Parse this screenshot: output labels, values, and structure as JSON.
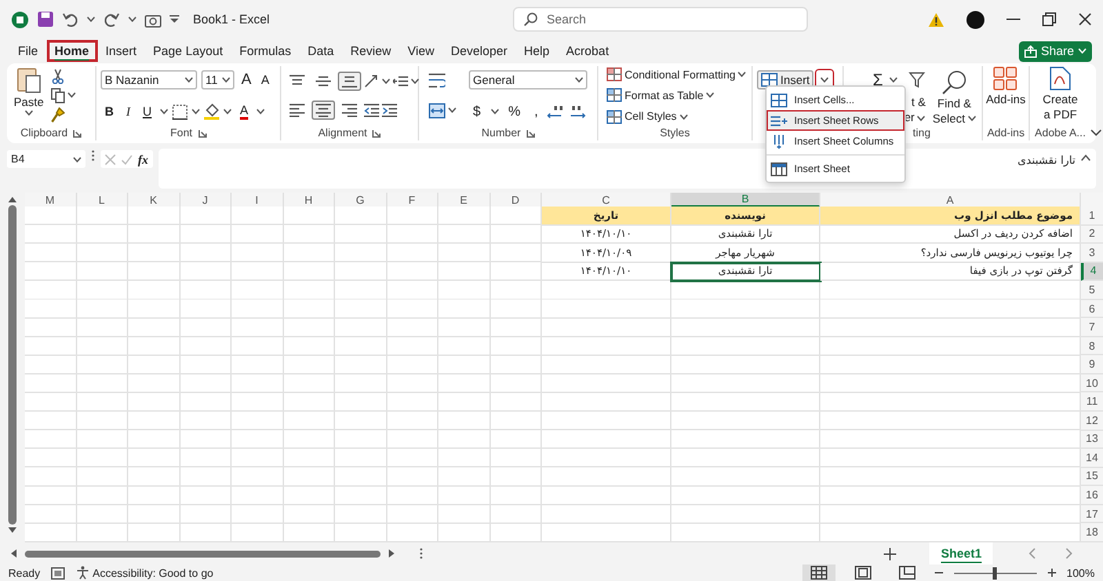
{
  "title_bar": {
    "document": "Book1 - Excel",
    "search": {
      "placeholder": "Search"
    }
  },
  "menu_tabs": [
    {
      "label": "File",
      "selected": false,
      "annotated": false
    },
    {
      "label": "Home",
      "selected": true,
      "annotated": true
    },
    {
      "label": "Insert",
      "selected": false,
      "annotated": false
    },
    {
      "label": "Page Layout",
      "selected": false,
      "annotated": false
    },
    {
      "label": "Formulas",
      "selected": false,
      "annotated": false
    },
    {
      "label": "Data",
      "selected": false,
      "annotated": false
    },
    {
      "label": "Review",
      "selected": false,
      "annotated": false
    },
    {
      "label": "View",
      "selected": false,
      "annotated": false
    },
    {
      "label": "Developer",
      "selected": false,
      "annotated": false
    },
    {
      "label": "Help",
      "selected": false,
      "annotated": false
    },
    {
      "label": "Acrobat",
      "selected": false,
      "annotated": false
    }
  ],
  "share_button": "Share",
  "ribbon": {
    "clipboard": {
      "paste": "Paste",
      "label": "Clipboard"
    },
    "font": {
      "font_name": "B Nazanin",
      "font_size": "11",
      "size_buttons": [
        {
          "kind": "grow",
          "label": "A"
        },
        {
          "kind": "shrink",
          "label": "A"
        }
      ],
      "format_buttons": [
        {
          "kind": "bold",
          "label": "B"
        },
        {
          "kind": "italic",
          "label": "I"
        },
        {
          "kind": "underline",
          "label": "U"
        }
      ],
      "font_color": "A",
      "label": "Font"
    },
    "alignment": {
      "top_row": [
        {
          "kind": "top",
          "selected": false
        },
        {
          "kind": "middle",
          "selected": false
        },
        {
          "kind": "bottom",
          "selected": true
        }
      ],
      "bottom_row": [
        {
          "kind": "left",
          "selected": false
        },
        {
          "kind": "center",
          "selected": true
        },
        {
          "kind": "right",
          "selected": false
        }
      ],
      "label": "Alignment"
    },
    "number": {
      "format": "General",
      "symbols": [
        "$",
        "%",
        ","
      ],
      "label": "Number"
    },
    "styles": {
      "items": [
        "Conditional Formatting",
        "Format as Table",
        "Cell Styles"
      ],
      "label": "Styles"
    },
    "cells": {
      "insert": "Insert",
      "caret_annotated": true
    },
    "editing": {
      "autosum": "Σ",
      "sort_lines": [
        "t &",
        "er"
      ],
      "find_lines": [
        "Find &",
        "Select"
      ],
      "label": "ting"
    },
    "addins": {
      "button": "Add-ins",
      "label": "Add-ins"
    },
    "adobe": {
      "button_lines": [
        "Create",
        "a PDF"
      ],
      "label": "Adobe A..."
    }
  },
  "insert_menu": {
    "items": [
      {
        "kind": "cells",
        "label": "Insert Cells...",
        "annotated": false
      },
      {
        "kind": "rows",
        "label": "Insert Sheet Rows",
        "annotated": true
      },
      {
        "kind": "columns",
        "label": "Insert Sheet Columns",
        "annotated": false
      },
      {
        "kind": "sheet",
        "label": "Insert Sheet",
        "annotated": false
      }
    ]
  },
  "formula_bar": {
    "name_box": "B4",
    "fx": "fx",
    "value": "تارا نقشبندی"
  },
  "sheet": {
    "columns": [
      {
        "label": "M",
        "selected": false
      },
      {
        "label": "L",
        "selected": false
      },
      {
        "label": "K",
        "selected": false
      },
      {
        "label": "J",
        "selected": false
      },
      {
        "label": "I",
        "selected": false
      },
      {
        "label": "H",
        "selected": false
      },
      {
        "label": "G",
        "selected": false
      },
      {
        "label": "F",
        "selected": false
      },
      {
        "label": "E",
        "selected": false
      },
      {
        "label": "D",
        "selected": false
      },
      {
        "label": "C",
        "selected": false
      },
      {
        "label": "B",
        "selected": true
      },
      {
        "label": "A",
        "selected": false
      }
    ],
    "rows": [
      {
        "number": "1",
        "selected": false,
        "kind": "header",
        "cells": [
          {
            "text": "موضوع مطلب انزل وب",
            "selected": false
          },
          {
            "text": "نویسنده",
            "selected": false
          },
          {
            "text": "تاریخ",
            "selected": false
          }
        ]
      },
      {
        "number": "2",
        "selected": false,
        "kind": "data",
        "cells": [
          {
            "text": "اضافه کردن ردیف در اکسل",
            "selected": false
          },
          {
            "text": "تارا نقشبندی",
            "selected": false
          },
          {
            "text": "۱۴۰۴/۱۰/۱۰",
            "selected": false
          }
        ]
      },
      {
        "number": "3",
        "selected": false,
        "kind": "data",
        "cells": [
          {
            "text": "چرا یوتیوب زیرنویس فارسی ندارد؟",
            "selected": false
          },
          {
            "text": "شهریار مهاجر",
            "selected": false
          },
          {
            "text": "۱۴۰۴/۱۰/۰۹",
            "selected": false
          }
        ]
      },
      {
        "number": "4",
        "selected": true,
        "kind": "data",
        "cells": [
          {
            "text": "گرفتن توپ در بازی فیفا",
            "selected": false
          },
          {
            "text": "تارا نقشبندی",
            "selected": true
          },
          {
            "text": "۱۴۰۴/۱۰/۱۰",
            "selected": false
          }
        ]
      },
      {
        "number": "5",
        "selected": false
      },
      {
        "number": "6",
        "selected": false
      },
      {
        "number": "7",
        "selected": false
      },
      {
        "number": "8",
        "selected": false
      },
      {
        "number": "9",
        "selected": false
      },
      {
        "number": "10",
        "selected": false
      },
      {
        "number": "11",
        "selected": false
      },
      {
        "number": "12",
        "selected": false
      },
      {
        "number": "13",
        "selected": false
      },
      {
        "number": "14",
        "selected": false
      },
      {
        "number": "15",
        "selected": false
      },
      {
        "number": "16",
        "selected": false
      },
      {
        "number": "17",
        "selected": false
      },
      {
        "number": "18",
        "selected": false
      }
    ]
  },
  "sheet_tabs": [
    {
      "label": "Sheet1",
      "selected": true
    }
  ],
  "status_bar": {
    "ready": "Ready",
    "accessibility": "Accessibility: Good to go",
    "views": [
      {
        "kind": "normal",
        "selected": true
      },
      {
        "kind": "page_layout",
        "selected": false
      },
      {
        "kind": "page_break",
        "selected": false
      }
    ],
    "zoom": {
      "level": 0.5,
      "reading": "100%"
    }
  }
}
